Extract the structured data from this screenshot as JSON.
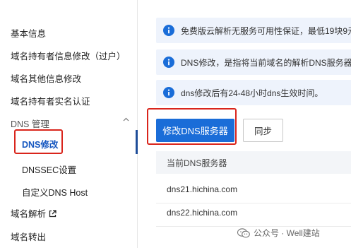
{
  "sidebar": {
    "items": [
      {
        "label": "基本信息"
      },
      {
        "label": "域名持有者信息修改（过户）"
      },
      {
        "label": "域名其他信息修改"
      },
      {
        "label": "域名持有者实名认证"
      },
      {
        "label": "DNS 管理"
      },
      {
        "label": "DNS修改"
      },
      {
        "label": "DNSSEC设置"
      },
      {
        "label": "自定义DNS Host"
      },
      {
        "label": "域名解析"
      },
      {
        "label": "域名转出"
      }
    ]
  },
  "notices": [
    {
      "text": "免费版云解析无服务可用性保证，最低19块9元"
    },
    {
      "text": "DNS修改，是指将当前域名的解析DNS服务器"
    },
    {
      "text": "dns修改后有24-48小时dns生效时间。"
    }
  ],
  "actions": {
    "primary_label": "修改DNS服务器",
    "secondary_label": "同步"
  },
  "dns_table": {
    "header": "当前DNS服务器",
    "rows": [
      "dns21.hichina.com",
      "dns22.hichina.com"
    ]
  },
  "watermark": {
    "text": "公众号 · Well建站"
  },
  "colors": {
    "accent": "#1a6dd8",
    "active_text": "#1557c0",
    "highlight": "#d9251c",
    "notice_bg": "#eef3fc"
  }
}
